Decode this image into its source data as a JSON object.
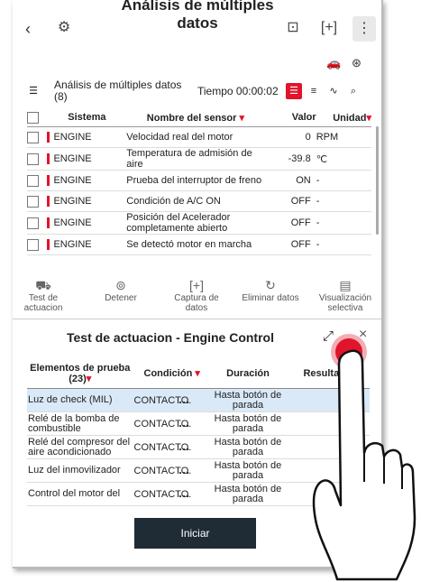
{
  "header": {
    "back_icon": "chevron-left-icon",
    "title": "Análisis de múltiples datos"
  },
  "subheader": {
    "label": "Análisis de múltiples datos (8)",
    "timer": "Tiempo 00:00:02"
  },
  "sensor_table": {
    "headers": [
      "Sistema",
      "Nombre del sensor",
      "Valor",
      "Unidad"
    ],
    "rows": [
      {
        "system": "ENGINE",
        "name": "Velocidad real del motor",
        "value": "0",
        "unit": "RPM"
      },
      {
        "system": "ENGINE",
        "name": "Temperatura de admisión de aire",
        "value": "-39.8",
        "unit": "℃"
      },
      {
        "system": "ENGINE",
        "name": "Prueba del interruptor de freno",
        "value": "ON",
        "unit": "-"
      },
      {
        "system": "ENGINE",
        "name": "Condición de A/C ON",
        "value": "OFF",
        "unit": "-"
      },
      {
        "system": "ENGINE",
        "name": "Posición del Acelerador completamente abierto",
        "value": "OFF",
        "unit": "-"
      },
      {
        "system": "ENGINE",
        "name": "Se detectó motor en marcha",
        "value": "OFF",
        "unit": "-"
      }
    ]
  },
  "toolbar": {
    "test": "Test de actuacion",
    "stop": "Detener",
    "capture": "Captura de datos",
    "delete": "Eliminar datos",
    "view": "Visualización selectiva"
  },
  "panel": {
    "title": "Test de actuacion  - Engine Control",
    "close": "×"
  },
  "actuation_table": {
    "headers": [
      "Elementos de prueba (23)",
      "Condición",
      "Duración",
      "Resultado"
    ],
    "rows": [
      {
        "item": "Luz de check (MIL)",
        "condition": "CONTACTO.",
        "duration": "Hasta botón de parada"
      },
      {
        "item": "Relé de la bomba de combustible",
        "condition": "CONTACTO.",
        "duration": "Hasta botón de parada"
      },
      {
        "item": "Relé del compresor del aire acondicionado",
        "condition": "CONTACTO.",
        "duration": "Hasta botón de parada"
      },
      {
        "item": "Luz del inmovilizador",
        "condition": "CONTACTO.",
        "duration": "Hasta botón de parada"
      },
      {
        "item": "Control del motor del",
        "condition": "CONTACTO.",
        "duration": "Hasta botón de parada"
      }
    ]
  },
  "start_button": "Iniciar",
  "colors": {
    "accent": "#e0142b",
    "dark_button": "#1f2c36",
    "selected_row": "#d9e9f8"
  }
}
